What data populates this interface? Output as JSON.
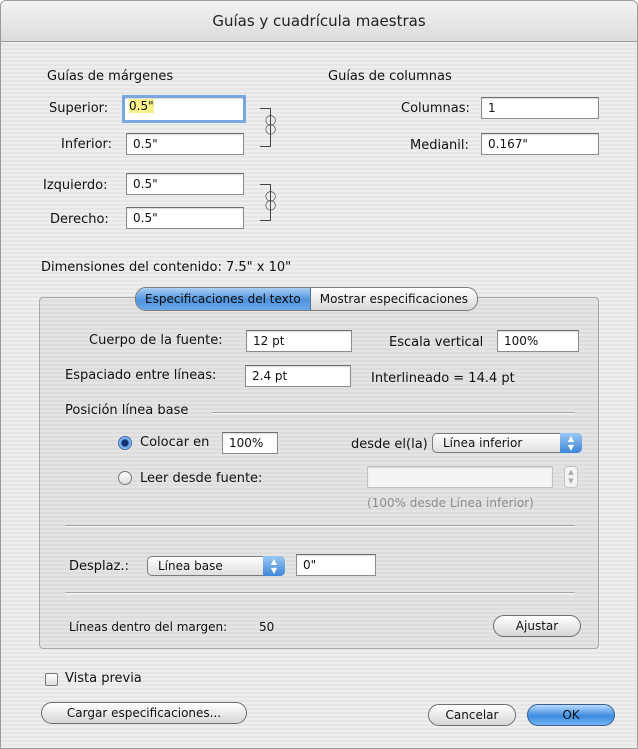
{
  "window": {
    "title": "Guías y cuadrícula maestras"
  },
  "margins": {
    "heading": "Guías de márgenes",
    "top_label": "Superior:",
    "top_value": "0.5\"",
    "bottom_label": "Inferior:",
    "bottom_value": "0.5\"",
    "left_label": "Izquierdo:",
    "left_value": "0.5\"",
    "right_label": "Derecho:",
    "right_value": "0.5\""
  },
  "columns": {
    "heading": "Guías de columnas",
    "count_label": "Columnas:",
    "count_value": "1",
    "gutter_label": "Medianil:",
    "gutter_value": "0.167\""
  },
  "content_dimensions": "Dimensiones del contenido:  7.5\" x 10\"",
  "tabs": [
    {
      "label": "Especificaciones del texto",
      "active": true
    },
    {
      "label": "Mostrar especificaciones",
      "active": false
    }
  ],
  "text_specs": {
    "font_size_label": "Cuerpo de la fuente:",
    "font_size_value": "12 pt",
    "vertical_scale_label": "Escala vertical",
    "vertical_scale_value": "100%",
    "line_spacing_label": "Espaciado entre líneas:",
    "line_spacing_value": "2.4 pt",
    "leading_text": "Interlineado = 14.4 pt",
    "baseline_heading": "Posición línea base",
    "place_at_label": "Colocar en",
    "place_at_value": "100%",
    "from_label": "desde el(la)",
    "from_popup": "Línea inferior",
    "read_from_font_label": "Leer desde fuente:",
    "read_from_font_note": "(100% desde Línea inferior)",
    "offset_label": "Desplaz.:",
    "offset_popup": "Línea base",
    "offset_value": "0\"",
    "lines_in_margin_label": "Líneas dentro del margen:",
    "lines_in_margin_value": "50",
    "adjust_button": "Ajustar"
  },
  "preview_label": "Vista previa",
  "load_specs_button": "Cargar especificaciones...",
  "cancel_button": "Cancelar",
  "ok_button": "OK",
  "colors": {
    "focus_ring": "#7aa7e0",
    "selection": "#f7f28c",
    "aqua_blue": "#4e93dc"
  }
}
